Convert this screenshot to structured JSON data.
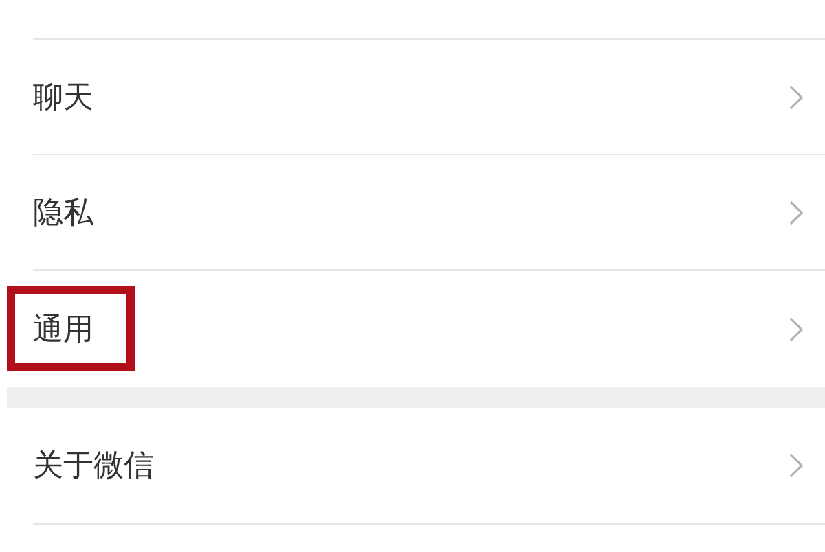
{
  "groups": [
    {
      "items": [
        {
          "label": "聊天",
          "highlighted": false
        },
        {
          "label": "隐私",
          "highlighted": false
        },
        {
          "label": "通用",
          "highlighted": true
        }
      ]
    },
    {
      "items": [
        {
          "label": "关于微信",
          "highlighted": false
        }
      ]
    }
  ]
}
